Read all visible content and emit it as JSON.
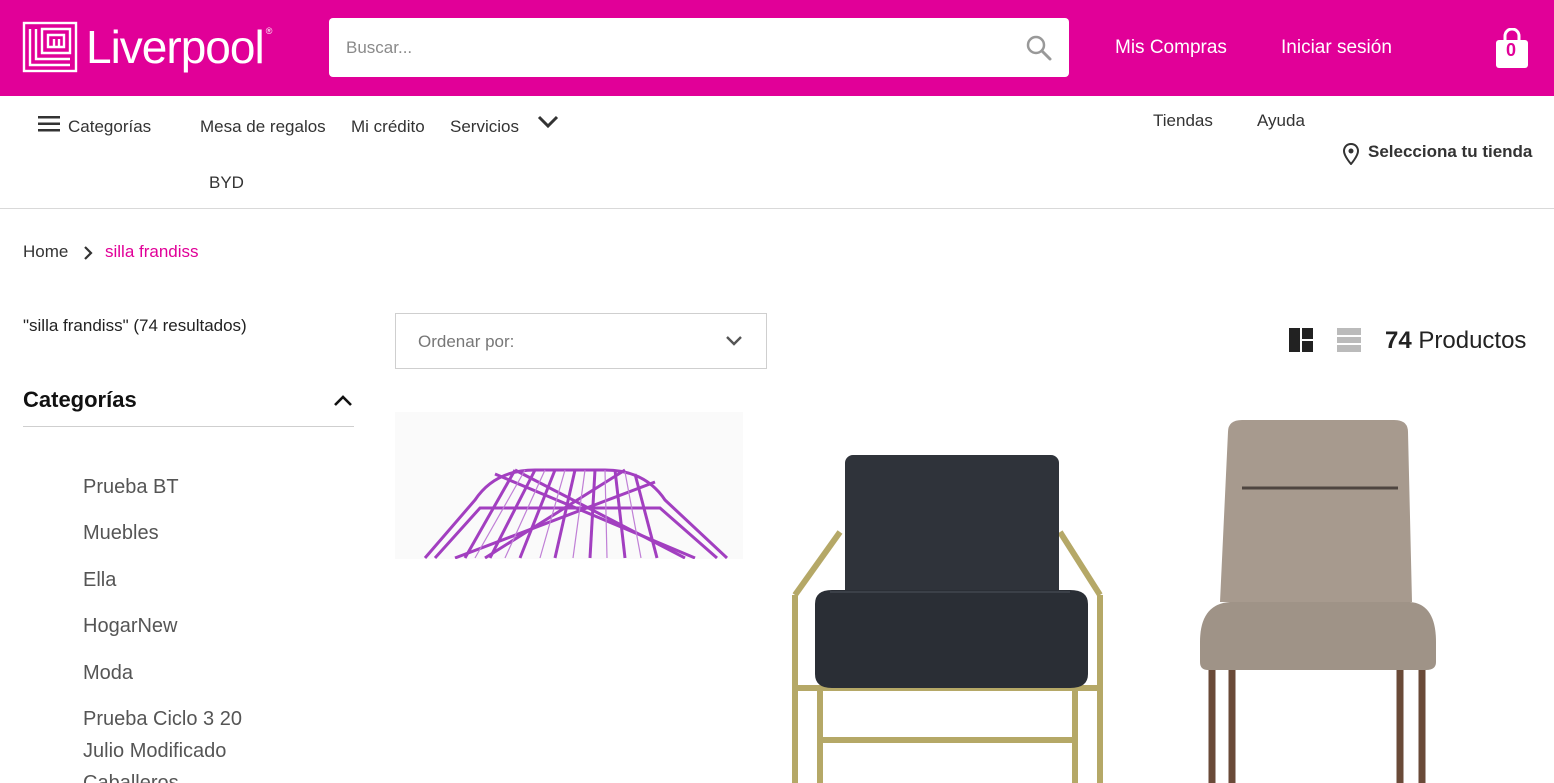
{
  "header": {
    "brand": "Liverpool",
    "search_placeholder": "Buscar...",
    "mis_compras": "Mis Compras",
    "iniciar_sesion": "Iniciar sesión",
    "bag_count": "0",
    "brand_color": "#e10098"
  },
  "nav": {
    "categorias": "Categorías",
    "mesa_regalos": "Mesa de regalos",
    "mi_credito": "Mi crédito",
    "servicios": "Servicios",
    "byd": "BYD",
    "tiendas": "Tiendas",
    "ayuda": "Ayuda",
    "selecciona_tienda": "Selecciona tu tienda"
  },
  "breadcrumb": {
    "home": "Home",
    "current": "silla frandiss"
  },
  "sidebar": {
    "results": "\"silla frandiss\" (74 resultados)",
    "categories_title": "Categorías",
    "items": [
      {
        "label": "Prueba BT"
      },
      {
        "label": "Muebles"
      },
      {
        "label": "Ella"
      },
      {
        "label": "HogarNew"
      },
      {
        "label": "Moda"
      },
      {
        "label": "Prueba Ciclo 3 20"
      },
      {
        "label": "Julio Modificado"
      },
      {
        "label": "Caballeros"
      }
    ]
  },
  "listing": {
    "sort_label": "Ordenar por:",
    "count_number": "74",
    "count_label": "Productos"
  },
  "products": [
    {
      "icon": "purple-wire-chair-image"
    },
    {
      "icon": "dark-armchair-image"
    },
    {
      "icon": "beige-rocking-chair-image"
    }
  ]
}
